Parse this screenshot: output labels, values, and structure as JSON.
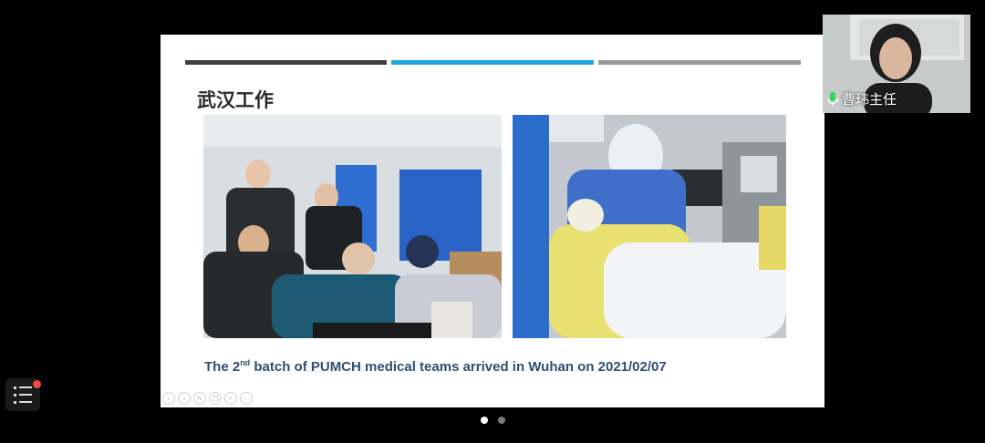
{
  "slide": {
    "title": "武汉工作",
    "caption": {
      "prefix": "The 2",
      "superscript": "nd",
      "suffix": " batch of PUMCH medical teams arrived in Wuhan on 2021/02/07"
    },
    "colors": {
      "bar1": "#3a3f44",
      "bar2": "#1ea6e0",
      "bar3": "#9a9a9a",
      "caption": "#2f4f72"
    },
    "photos": [
      "medical-team-meeting-photo",
      "icu-patient-care-photo"
    ],
    "toolbar_icons": [
      "arrow-left-icon",
      "arrow-right-icon",
      "pen-icon",
      "copy-icon",
      "zoom-icon",
      "more-icon"
    ]
  },
  "participant": {
    "name": "曹玮主任",
    "mic_icon": "microphone-icon"
  },
  "menu": {
    "icon": "menu-list-icon",
    "has_notification": true
  },
  "pager": {
    "total": 2,
    "active": 1
  }
}
